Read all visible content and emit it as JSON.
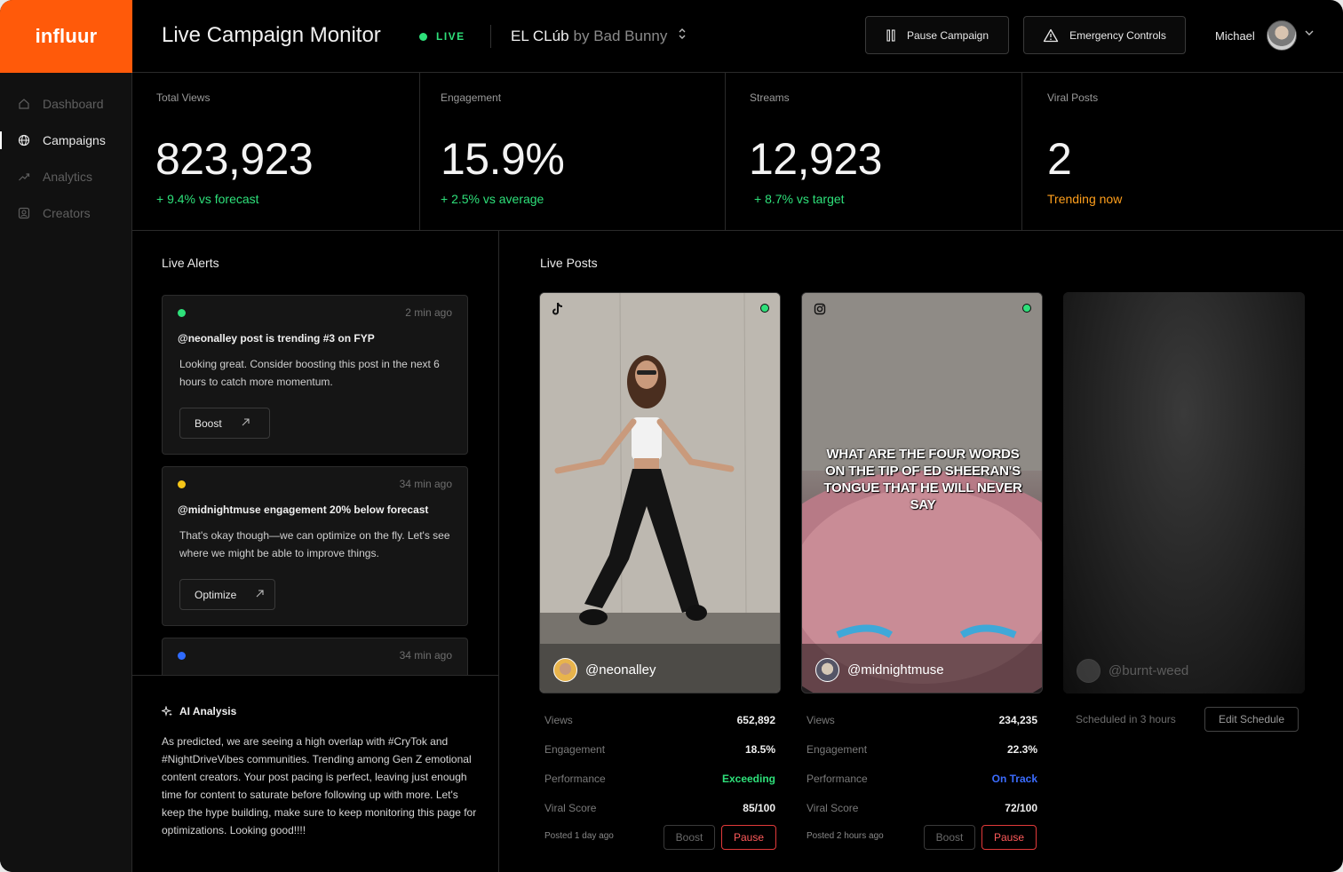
{
  "app": {
    "logo": "influur"
  },
  "sidebar": {
    "items": [
      {
        "label": "Dashboard",
        "icon": "home-icon"
      },
      {
        "label": "Campaigns",
        "icon": "globe-icon",
        "active": true
      },
      {
        "label": "Analytics",
        "icon": "trend-icon"
      },
      {
        "label": "Creators",
        "icon": "user-icon"
      }
    ]
  },
  "header": {
    "title": "Live Campaign Monitor",
    "live_label": "LIVE",
    "campaign_name": "EL CLúb",
    "campaign_by": "by Bad Bunny",
    "pause_label": "Pause Campaign",
    "emergency_label": "Emergency Controls",
    "user_name": "Michael"
  },
  "stats": [
    {
      "label": "Total Views",
      "value": "823,923",
      "sub": "+ 9.4% vs forecast"
    },
    {
      "label": "Engagement",
      "value": "15.9%",
      "sub": "+ 2.5% vs average"
    },
    {
      "label": "Streams",
      "value": "12,923",
      "sub": "+ 8.7% vs target"
    },
    {
      "label": "Viral Posts",
      "value": "2",
      "sub": "Trending now"
    }
  ],
  "alerts": {
    "title": "Live Alerts",
    "items": [
      {
        "dot_color": "#2ee07a",
        "time": "2 min ago",
        "title": "@neonalley post is trending #3 on FYP",
        "body": "Looking great. Consider boosting this post in the next 6 hours to catch more momentum.",
        "action": "Boost"
      },
      {
        "dot_color": "#f5c518",
        "time": "34 min ago",
        "title": "@midnightmuse engagement 20% below forecast",
        "body": "That's okay though—we can optimize on the fly. Let's see where we might be able to improve things.",
        "action": "Optimize"
      },
      {
        "dot_color": "#2f6bff",
        "time": "34 min ago"
      }
    ]
  },
  "ai": {
    "title": "AI Analysis",
    "text": "As predicted, we are seeing a high overlap with #CryTok and #NightDriveVibes communities. Trending among Gen Z emotional content creators. Your post pacing is perfect, leaving just enough time for content to saturate before following up with more. Let's keep the hype building, make sure to keep monitoring this page for optimizations. Looking good!!!!"
  },
  "posts": {
    "title": "Live Posts",
    "items": [
      {
        "handle": "@neonalley",
        "platform": "tiktok-icon",
        "views_label": "Views",
        "views": "652,892",
        "engagement_label": "Engagement",
        "engagement": "18.5%",
        "performance_label": "Performance",
        "performance": "Exceeding",
        "viral_label": "Viral Score",
        "viral": "85/100",
        "posted": "Posted 1 day ago",
        "boost": "Boost",
        "pause": "Pause"
      },
      {
        "handle": "@midnightmuse",
        "platform": "instagram-icon",
        "overlay": "WHAT ARE THE FOUR WORDS ON THE TIP OF ED SHEERAN'S TONGUE THAT HE WILL NEVER SAY",
        "views_label": "Views",
        "views": "234,235",
        "engagement_label": "Engagement",
        "engagement": "22.3%",
        "performance_label": "Performance",
        "performance": "On Track",
        "viral_label": "Viral Score",
        "viral": "72/100",
        "posted": "Posted 2 hours ago",
        "boost": "Boost",
        "pause": "Pause"
      },
      {
        "handle": "@burnt-weed",
        "scheduled": "Scheduled in 3 hours",
        "edit": "Edit Schedule"
      }
    ]
  },
  "colors": {
    "brand": "#ff5a0a",
    "positive": "#2ee07a",
    "warning": "#ff9f1c",
    "info": "#3b6cff",
    "danger": "#ff5a5a"
  }
}
